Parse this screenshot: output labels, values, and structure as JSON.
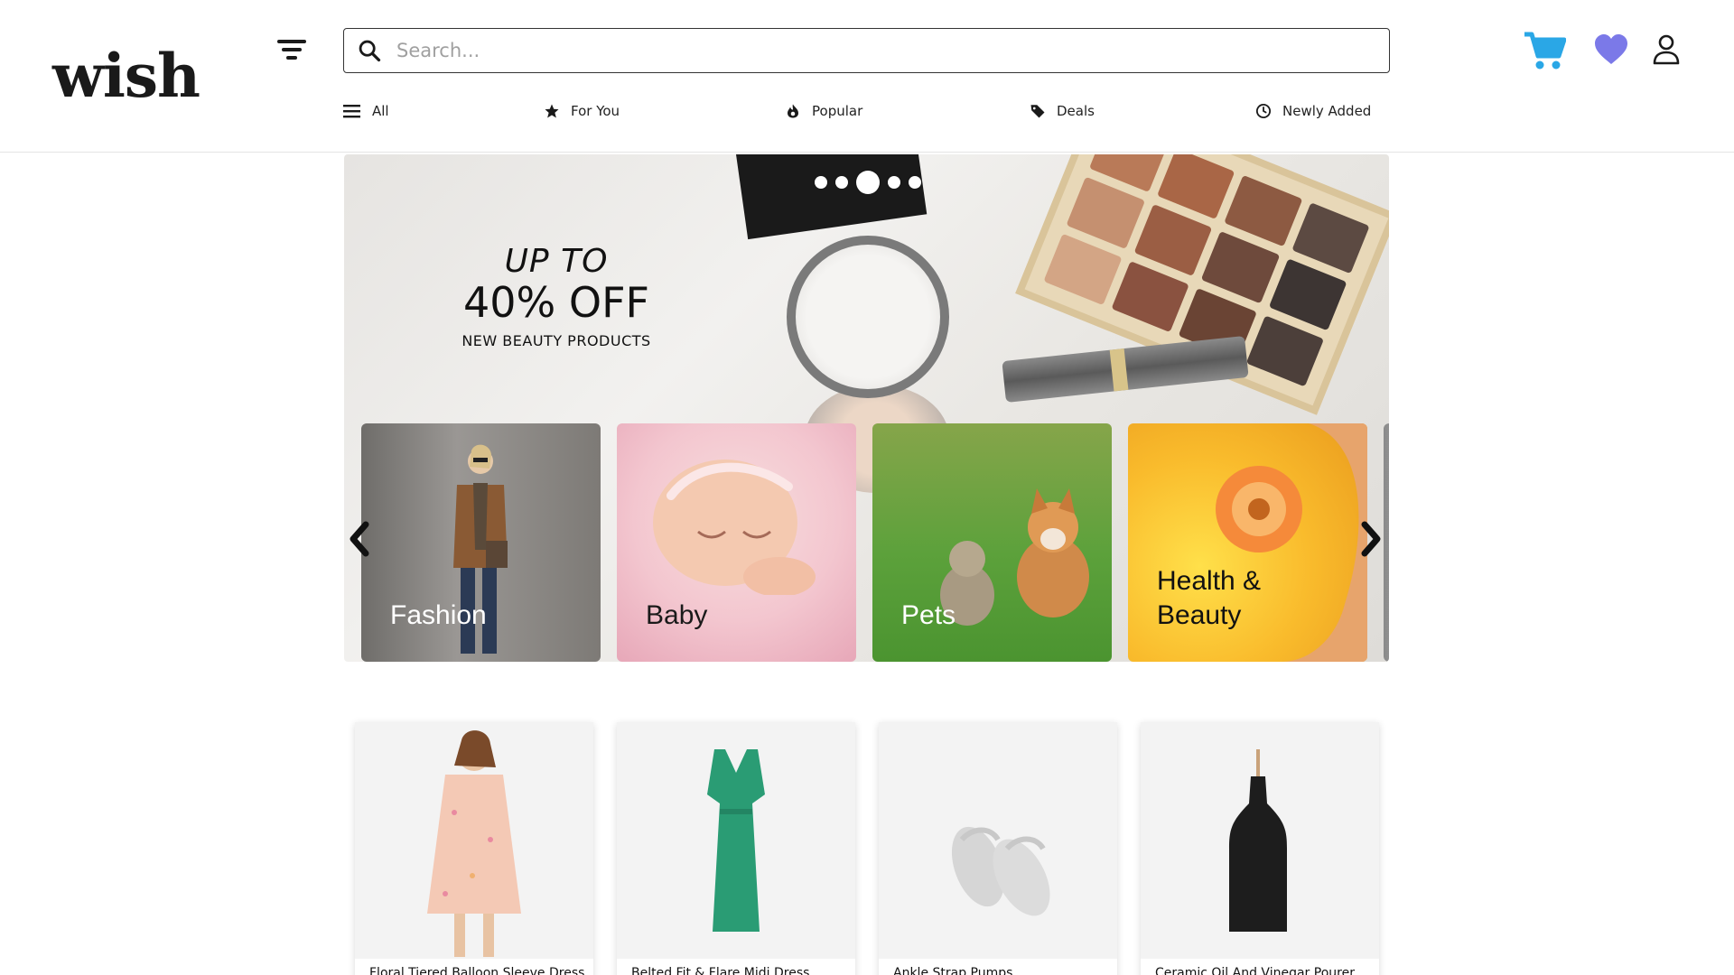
{
  "header": {
    "logo": "wish",
    "search_placeholder": "Search...",
    "nav": [
      {
        "label": "All",
        "icon": "menu-icon"
      },
      {
        "label": "For You",
        "icon": "star-icon"
      },
      {
        "label": "Popular",
        "icon": "fire-icon"
      },
      {
        "label": "Deals",
        "icon": "tag-icon"
      },
      {
        "label": "Newly Added",
        "icon": "clock-icon"
      }
    ],
    "icons": {
      "cart": "cart-icon",
      "wishlist": "heart-icon",
      "account": "user-icon"
    },
    "colors": {
      "cart": "#2aa7e6",
      "heart": "#7b79e8"
    }
  },
  "hero": {
    "promo_line1": "UP TO",
    "promo_line2": "40% OFF",
    "promo_line3": "NEW BEAUTY PRODUCTS",
    "slide_count": 5,
    "active_slide": 3,
    "categories": [
      {
        "label": "Fashion"
      },
      {
        "label": "Baby"
      },
      {
        "label": "Pets"
      },
      {
        "label": "Health & Beauty"
      }
    ]
  },
  "products": [
    {
      "name": "Floral Tiered Balloon Sleeve Dress"
    },
    {
      "name": "Belted Fit & Flare Midi Dress"
    },
    {
      "name": "Ankle Strap Pumps"
    },
    {
      "name": "Ceramic Oil And Vinegar Pourer"
    }
  ]
}
